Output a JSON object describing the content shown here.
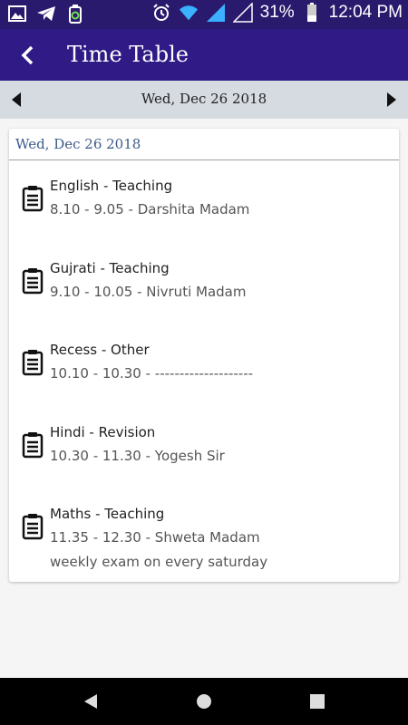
{
  "status_bar": {
    "battery_percent": "31%",
    "time": "12:04 PM",
    "icons": [
      "image-icon",
      "telegram-icon",
      "recycle-icon",
      "alarm-icon",
      "wifi-icon",
      "signal-icon",
      "no-signal-icon",
      "battery-icon"
    ]
  },
  "app_bar": {
    "title": "Time Table",
    "back_icon": "back-arrow-icon",
    "color": "#2f1a86"
  },
  "date_nav": {
    "date": "Wed, Dec 26 2018",
    "prev_icon": "triangle-left-icon",
    "next_icon": "triangle-right-icon"
  },
  "card": {
    "header": "Wed, Dec 26 2018",
    "entries": [
      {
        "subject": "English",
        "type": "Teaching",
        "time": "8.10 - 9.05",
        "teacher": "Darshita Madam",
        "note": ""
      },
      {
        "subject": "Gujrati",
        "type": "Teaching",
        "time": "9.10 - 10.05",
        "teacher": "Nivruti Madam",
        "note": ""
      },
      {
        "subject": "Recess",
        "type": "Other",
        "time": "10.10 - 10.30",
        "teacher": "--------------------",
        "note": ""
      },
      {
        "subject": "Hindi",
        "type": "Revision",
        "time": "10.30 - 11.30",
        "teacher": "Yogesh Sir",
        "note": ""
      },
      {
        "subject": "Maths",
        "type": "Teaching",
        "time": "11.35 - 12.30",
        "teacher": "Shweta Madam",
        "note": "weekly exam on every saturday"
      }
    ]
  },
  "system_nav": {
    "icons": [
      "back-triangle-icon",
      "home-circle-icon",
      "recents-square-icon"
    ]
  }
}
